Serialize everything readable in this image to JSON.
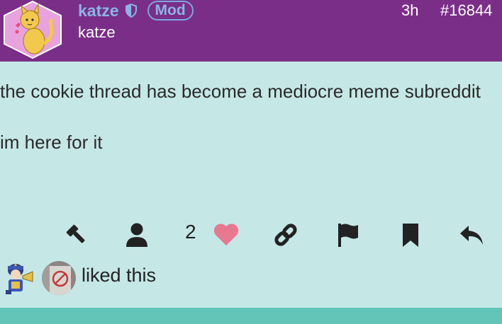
{
  "post": {
    "username": "katze",
    "display_name": "katze",
    "badge": "Mod",
    "time": "3h",
    "post_number": "#16844",
    "paragraphs": [
      "the cookie thread has become a mediocre meme subreddit",
      "im here for it"
    ]
  },
  "actions": {
    "like_count": "2"
  },
  "likers": {
    "text": "liked this"
  },
  "colors": {
    "header_bg": "#7a2e87",
    "body_bg": "#c5e7e6",
    "footer_bar": "#63c5b8",
    "username": "#8ab3e6",
    "heart": "#e87790"
  },
  "icons": [
    "gavel-icon",
    "user-icon",
    "heart-icon",
    "link-icon",
    "flag-icon",
    "bookmark-icon",
    "reply-icon",
    "shield-icon"
  ]
}
